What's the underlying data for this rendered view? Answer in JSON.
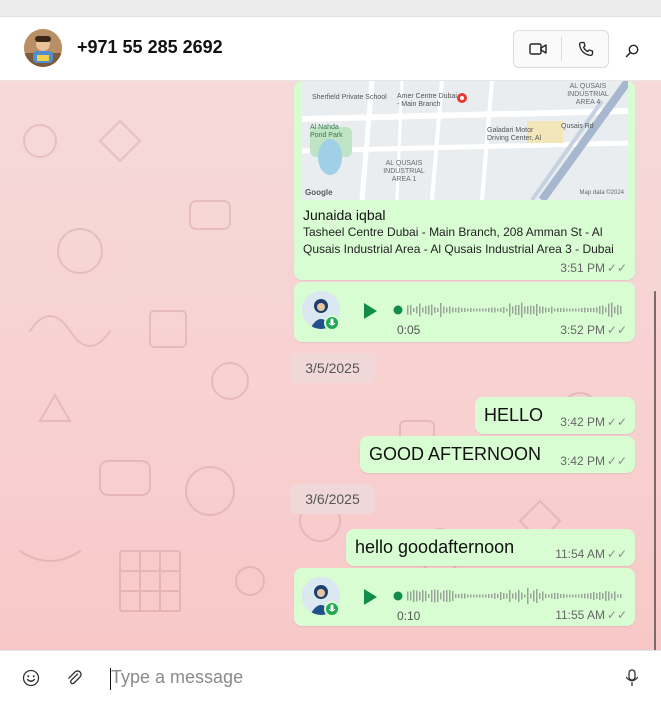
{
  "header": {
    "contact_name": "+971 55 285 2692",
    "icons": {
      "video": "video-camera-icon",
      "call": "phone-icon",
      "search": "search-icon"
    }
  },
  "messages": {
    "location": {
      "map_labels": {
        "sherfield": "Sherfield Private School",
        "amer": "Amer Centre Dubai - Main Branch",
        "nahda": "Al Nahda Pond Park",
        "qusais_area1": "AL QUSAIS INDUSTRIAL AREA 1",
        "qusais_area4": "AL QUSAIS INDUSTRIAL AREA 4",
        "galadari": "Galadari Motor Driving Center, Al",
        "qusais_stop": "Qusais Rd",
        "google": "Google",
        "mapdata": "Map data ©2024"
      },
      "title": "Junaida iqbal",
      "address": "Tasheel Centre Dubai - Main Branch, 208 Amman St - Al Qusais Industrial Area - Al Qusais Industrial Area 3 - Dubai",
      "time": "3:51 PM"
    },
    "voice1": {
      "duration": "0:05",
      "time": "3:52 PM"
    },
    "date1": "3/5/2025",
    "hello": {
      "text": "HELLO",
      "time": "3:42 PM"
    },
    "afternoon": {
      "text": "GOOD AFTERNOON",
      "time": "3:42 PM"
    },
    "date2": "3/6/2025",
    "hello_good": {
      "text": "hello goodafternoon",
      "time": "11:54 AM"
    },
    "voice2": {
      "duration": "0:10",
      "time": "11:55 AM"
    },
    "read_ticks": "✓✓"
  },
  "composer": {
    "placeholder": "Type a message",
    "icons": {
      "emoji": "emoji-icon",
      "attach": "paperclip-icon",
      "mic": "microphone-icon"
    }
  },
  "colors": {
    "bubble_outgoing": "#d9fdd3",
    "chat_background": "#f8d0d0",
    "accent_green": "#128c4a"
  }
}
